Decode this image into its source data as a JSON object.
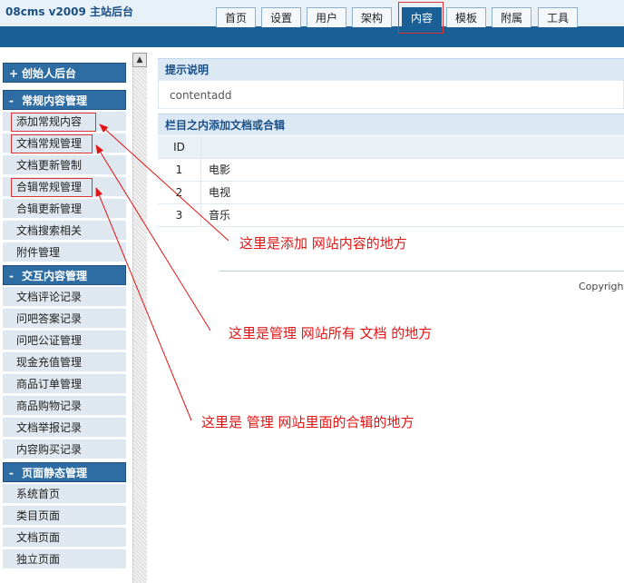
{
  "header": {
    "logo": "08cms  v2009  主站后台",
    "nav": [
      "首页",
      "设置",
      "用户",
      "架构",
      "内容",
      "模板",
      "附属",
      "工具"
    ],
    "active_tab": "内容"
  },
  "sidebar": {
    "sections": [
      {
        "symbol": "+",
        "title": "创始人后台",
        "items": []
      },
      {
        "symbol": "-",
        "title": "常规内容管理",
        "items": [
          "添加常规内容",
          "文档常规管理",
          "文档更新管制",
          "合辑常规管理",
          "合辑更新管理",
          "文档搜索相关",
          "附件管理"
        ]
      },
      {
        "symbol": "-",
        "title": "交互内容管理",
        "items": [
          "文档评论记录",
          "问吧答案记录",
          "问吧公证管理",
          "现金充值管理",
          "商品订单管理",
          "商品购物记录",
          "文档举报记录",
          "内容购买记录"
        ]
      },
      {
        "symbol": "-",
        "title": "页面静态管理",
        "items": [
          "系统首页",
          "类目页面",
          "文档页面",
          "独立页面"
        ]
      }
    ]
  },
  "main": {
    "hint_title": "提示说明",
    "hint_text": "contentadd",
    "table_title": "栏目之内添加文档或合辑",
    "table_header": "ID",
    "rows": [
      {
        "id": "1",
        "name": "电影"
      },
      {
        "id": "2",
        "name": "电视"
      },
      {
        "id": "3",
        "name": "音乐"
      }
    ],
    "copyright": "Copyright"
  },
  "annotations": [
    "这里是添加  网站内容的地方",
    "这里是管理  网站所有  文档  的地方",
    "这里是  管理  网站里面的合辑的地方"
  ],
  "colors": {
    "header_bar": "#1a5f95",
    "section_head": "#2e6da4",
    "annotation": "#e21515"
  }
}
